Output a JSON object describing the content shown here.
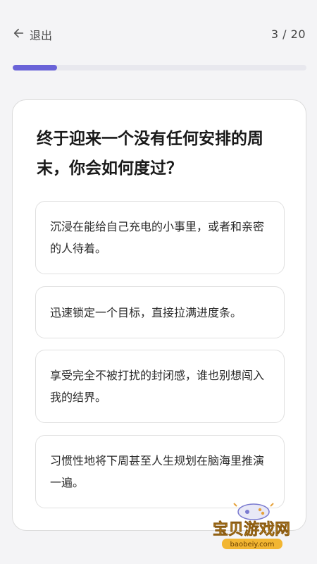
{
  "header": {
    "back_label": "退出",
    "counter": "3 / 20",
    "progress_fraction": 0.15
  },
  "question": {
    "text": "终于迎来一个没有任何安排的周末，你会如何度过？"
  },
  "options": [
    {
      "text": "沉浸在能给自己充电的小事里，或者和亲密的人待着。"
    },
    {
      "text": "迅速锁定一个目标，直接拉满进度条。"
    },
    {
      "text": "享受完全不被打扰的封闭感，谁也别想闯入我的结界。"
    },
    {
      "text": "习惯性地将下周甚至人生规划在脑海里推演一遍。"
    }
  ],
  "watermark": {
    "title": "宝贝游戏网",
    "url": "baobeiy.com"
  },
  "colors": {
    "accent": "#6a63d8",
    "background": "#f4f4f6",
    "card": "#ffffff"
  }
}
